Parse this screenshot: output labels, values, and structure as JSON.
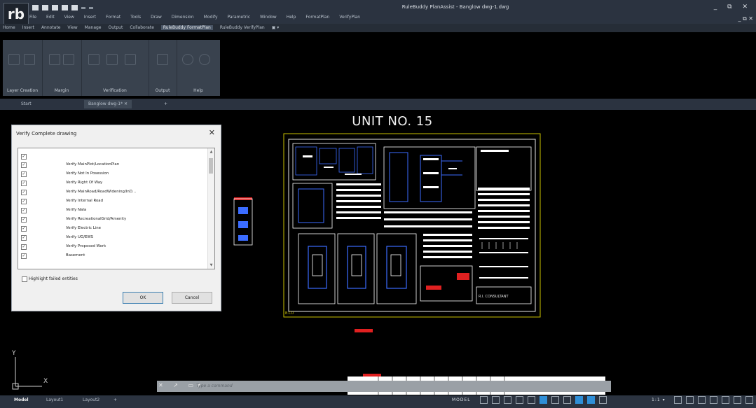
{
  "app": {
    "title": "RuleBuddy PlanAssist - Banglow dwg-1.dwg",
    "logo_text": "rb",
    "window_controls": "_ ⧉ ✕",
    "mdi_controls": "_ ⧉ ✕"
  },
  "menu": [
    "File",
    "Edit",
    "View",
    "Insert",
    "Format",
    "Tools",
    "Draw",
    "Dimension",
    "Modify",
    "Parametric",
    "Window",
    "Help",
    "FormatPlan",
    "VerifyPlan"
  ],
  "ribbon_tabs": [
    "Home",
    "Insert",
    "Annotate",
    "View",
    "Manage",
    "Output",
    "Collaborate",
    "RuleBuddy FormatPlan",
    "RuleBuddy VerifyPlan",
    "▣ ▾"
  ],
  "ribbon_active_tab": "RuleBuddy FormatPlan",
  "ribbon_panels": [
    "Layer Creation",
    "Margin",
    "Verification",
    "Output",
    "Help"
  ],
  "doc_tabs": {
    "start": "Start",
    "active": "Banglow dwg-1* ✕",
    "add": "+"
  },
  "drawing": {
    "title": "UNIT NO. 15",
    "consultant_label": "R.I. CONSULTANT",
    "frame_label": "B.CU"
  },
  "dialog": {
    "title": "Verify Complete drawing",
    "close": "✕",
    "items": [
      {
        "label": "",
        "checked": true
      },
      {
        "label": "Verify MainPlot/LocationPlan",
        "checked": true
      },
      {
        "label": "Verify Not In Posession",
        "checked": true
      },
      {
        "label": "Verify Right Of Way",
        "checked": true
      },
      {
        "label": "Verify MainRoad/RoadWidening/InD...",
        "checked": true
      },
      {
        "label": "Verify Internal Road",
        "checked": true
      },
      {
        "label": "Verify Nala",
        "checked": true
      },
      {
        "label": "Verify RecreationalGrid/Amenity",
        "checked": true
      },
      {
        "label": "Verify Electric Line",
        "checked": true
      },
      {
        "label": "Verify UG/EWS",
        "checked": true
      },
      {
        "label": "Verify Proposed Work",
        "checked": true
      },
      {
        "label": "Basement",
        "checked": true
      }
    ],
    "highlight_label": "Highlight failed entities",
    "highlight_checked": false,
    "ok_label": "OK",
    "cancel_label": "Cancel"
  },
  "command_line": {
    "placeholder": "Type a command",
    "icons": "✕ ↗ ▭▾"
  },
  "layout_tabs": [
    "Model",
    "Layout1",
    "Layout2",
    "+"
  ],
  "status": {
    "model_label": "MODEL",
    "scale": "1:1 ▾"
  },
  "ucs": {
    "y": "Y",
    "x": "X"
  },
  "colors": {
    "accent": "#2f8fd8",
    "sheet_border": "#c9c100",
    "background": "#000000"
  }
}
